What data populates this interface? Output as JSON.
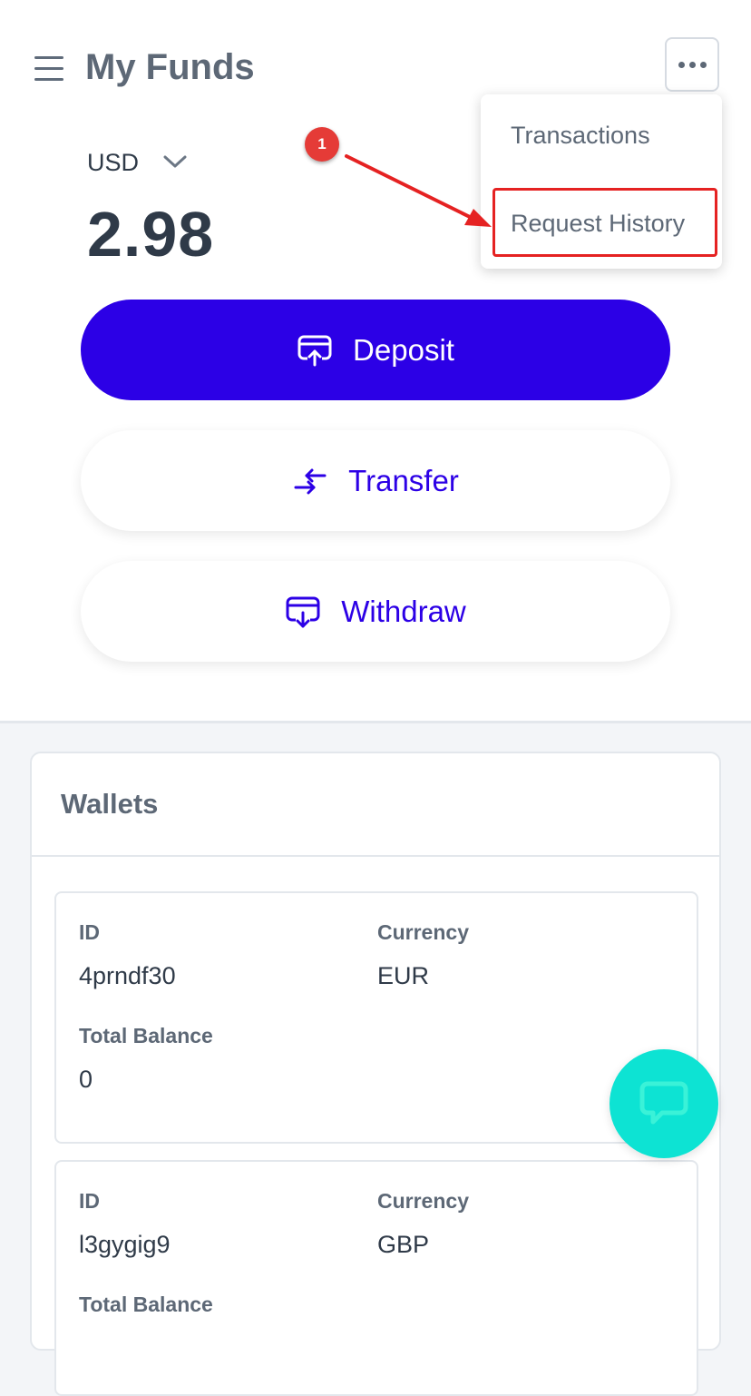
{
  "header": {
    "title": "My Funds",
    "menu_icon": "hamburger-icon",
    "more_icon": "more-horizontal-icon"
  },
  "dropdown_menu": {
    "items": [
      "Transactions",
      "Request History"
    ]
  },
  "annotation": {
    "step": "1",
    "color": "#e52222"
  },
  "balance": {
    "currency": "USD",
    "amount": "2.98"
  },
  "actions": {
    "deposit": "Deposit",
    "transfer": "Transfer",
    "withdraw": "Withdraw"
  },
  "wallets": {
    "title": "Wallets",
    "items": [
      {
        "id_label": "ID",
        "id": "4prndf30",
        "currency_label": "Currency",
        "currency": "EUR",
        "balance_label": "Total Balance",
        "balance": "0"
      },
      {
        "id_label": "ID",
        "id": "l3gygig9",
        "currency_label": "Currency",
        "currency": "GBP",
        "balance_label": "Total Balance",
        "balance": ""
      }
    ]
  },
  "colors": {
    "primary": "#2c00e6",
    "chat": "#0de3d3",
    "text": "#2f3a48",
    "muted": "#5d6876"
  }
}
